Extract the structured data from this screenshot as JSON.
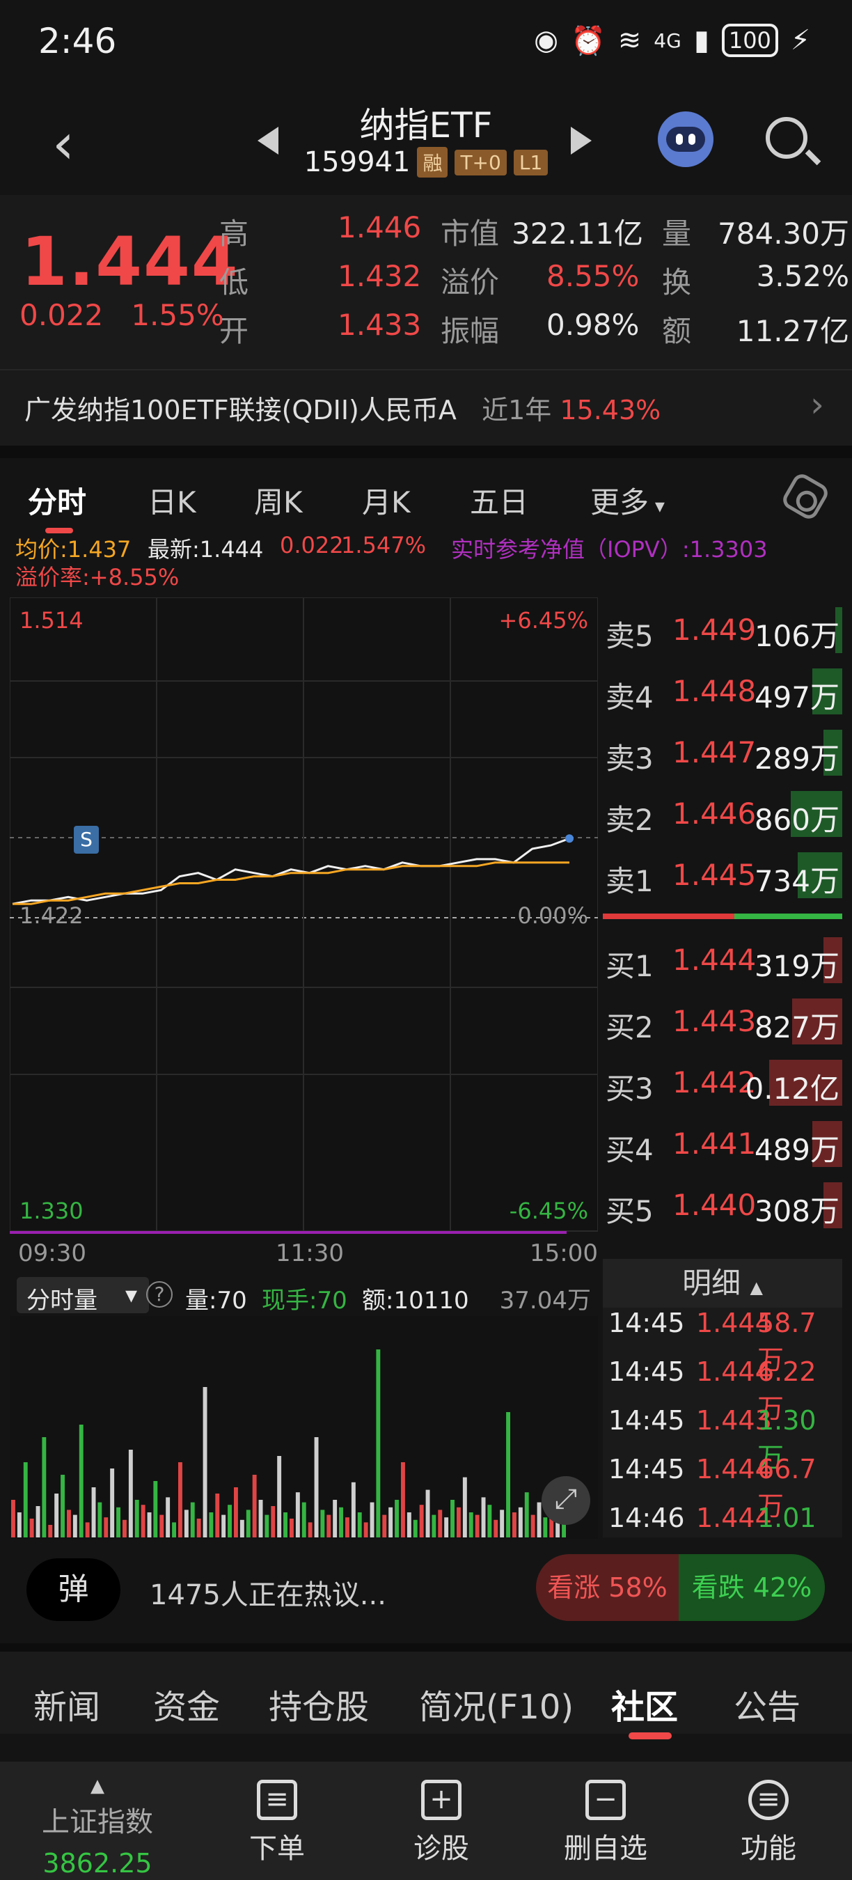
{
  "status_bar": {
    "time": "2:46",
    "network": "4G",
    "battery": "100"
  },
  "header": {
    "title": "纳指ETF",
    "code": "159941",
    "tags": [
      "融",
      "T+0",
      "L1"
    ]
  },
  "quote": {
    "price": "1.444",
    "change": "0.022",
    "change_pct": "1.55%",
    "rows": [
      {
        "l1": "高",
        "v1": "1.446",
        "l2": "市值",
        "v2": "322.11亿",
        "l3": "量",
        "v3": "784.30万"
      },
      {
        "l1": "低",
        "v1": "1.432",
        "l2": "溢价",
        "v2": "8.55%",
        "l3": "换",
        "v3": "3.52%"
      },
      {
        "l1": "开",
        "v1": "1.433",
        "l2": "振幅",
        "v2": "0.98%",
        "l3": "额",
        "v3": "11.27亿"
      }
    ],
    "fund_name": "广发纳指100ETF联接(QDII)人民币A",
    "fund_period": "近1年",
    "fund_return": "15.43%"
  },
  "tabs": [
    "分时",
    "日K",
    "周K",
    "月K",
    "五日",
    "更多"
  ],
  "info": {
    "avg": "均价:1.437",
    "latest": "最新:1.444",
    "chg": "0.022",
    "chg_pct": "1.547%",
    "iopv": "实时参考净值（IOPV）:1.3303",
    "premium": "溢价率:+8.55%"
  },
  "chart": {
    "top_price": "1.514",
    "top_pct": "+6.45%",
    "mid_price": "1.422",
    "mid_pct": "0.00%",
    "bot_price": "1.330",
    "bot_pct": "-6.45%",
    "times": [
      "09:30",
      "11:30",
      "15:00"
    ],
    "marker": "S"
  },
  "chart_data": {
    "type": "line",
    "ylim": [
      1.33,
      1.514
    ],
    "series": [
      {
        "values": [
          1.425,
          1.426,
          1.426,
          1.427,
          1.426,
          1.427,
          1.428,
          1.428,
          1.429,
          1.433,
          1.434,
          1.432,
          1.435,
          1.434,
          1.433,
          1.435,
          1.434,
          1.436,
          1.435,
          1.436,
          1.435,
          1.437,
          1.436,
          1.436,
          1.437,
          1.438,
          1.438,
          1.437,
          1.441,
          1.442,
          1.444
        ]
      },
      {
        "values": [
          1.425,
          1.425,
          1.426,
          1.426,
          1.427,
          1.428,
          1.428,
          1.429,
          1.43,
          1.431,
          1.431,
          1.432,
          1.432,
          1.433,
          1.433,
          1.434,
          1.434,
          1.434,
          1.435,
          1.435,
          1.435,
          1.436,
          1.436,
          1.436,
          1.436,
          1.436,
          1.437,
          1.437,
          1.437,
          1.437,
          1.437
        ]
      }
    ],
    "volume": [
      30,
      20,
      60,
      15,
      25,
      80,
      10,
      35,
      50,
      22,
      18,
      90,
      12,
      40,
      28,
      16,
      55,
      24,
      14,
      70,
      30,
      26,
      20,
      45,
      18,
      32,
      12,
      60,
      22,
      28,
      15,
      120,
      20,
      35,
      18,
      26,
      40,
      14,
      22,
      50,
      30,
      18,
      25,
      65,
      20,
      15,
      36,
      28,
      12,
      80,
      22,
      18,
      30,
      24,
      16,
      44,
      20,
      12,
      28,
      150,
      18,
      24,
      30,
      60,
      20,
      14,
      26,
      38,
      18,
      22,
      16,
      30,
      24,
      48,
      20,
      18,
      32,
      26,
      14,
      22,
      100,
      20,
      24,
      36,
      18,
      28,
      16,
      22,
      40,
      30
    ]
  },
  "order_book": {
    "sell": [
      {
        "label": "卖5",
        "price": "1.449",
        "vol": "106万",
        "ratio": 0.08
      },
      {
        "label": "卖4",
        "price": "1.448",
        "vol": "497万",
        "ratio": 0.35
      },
      {
        "label": "卖3",
        "price": "1.447",
        "vol": "289万",
        "ratio": 0.22
      },
      {
        "label": "卖2",
        "price": "1.446",
        "vol": "860万",
        "ratio": 0.6
      },
      {
        "label": "卖1",
        "price": "1.445",
        "vol": "734万",
        "ratio": 0.52
      }
    ],
    "buy": [
      {
        "label": "买1",
        "price": "1.444",
        "vol": "319万",
        "ratio": 0.22
      },
      {
        "label": "买2",
        "price": "1.443",
        "vol": "827万",
        "ratio": 0.58
      },
      {
        "label": "买3",
        "price": "1.442",
        "vol": "0.12亿",
        "ratio": 0.85
      },
      {
        "label": "买4",
        "price": "1.441",
        "vol": "489万",
        "ratio": 0.35
      },
      {
        "label": "买5",
        "price": "1.440",
        "vol": "308万",
        "ratio": 0.22
      }
    ]
  },
  "detail": {
    "title": "明细",
    "rows": [
      {
        "time": "14:45",
        "price": "1.444",
        "vol": "58.7万",
        "dir": "red"
      },
      {
        "time": "14:45",
        "price": "1.444",
        "vol": "6.22万",
        "dir": "red"
      },
      {
        "time": "14:45",
        "price": "1.443",
        "vol": "1.30万",
        "dir": "green"
      },
      {
        "time": "14:45",
        "price": "1.444",
        "vol": "66.7万",
        "dir": "red"
      },
      {
        "time": "14:46",
        "price": "1.444",
        "vol": "1.01万",
        "dir": "green"
      }
    ]
  },
  "volume_head": {
    "select": "分时量",
    "qty": "量:70",
    "hand": "现手:70",
    "amount": "额:10110",
    "max": "37.04万"
  },
  "discussion": {
    "danmu": "弹",
    "text": "1475人正在热议...",
    "bull": "看涨 58%",
    "bear": "看跌 42%"
  },
  "bottom_tabs": [
    "新闻",
    "资金",
    "持仓股",
    "简况(F10)",
    "社区",
    "公告"
  ],
  "nav": {
    "index_name": "上证指数",
    "index_value": "3862.25",
    "items": [
      "下单",
      "诊股",
      "删自选",
      "功能"
    ]
  }
}
